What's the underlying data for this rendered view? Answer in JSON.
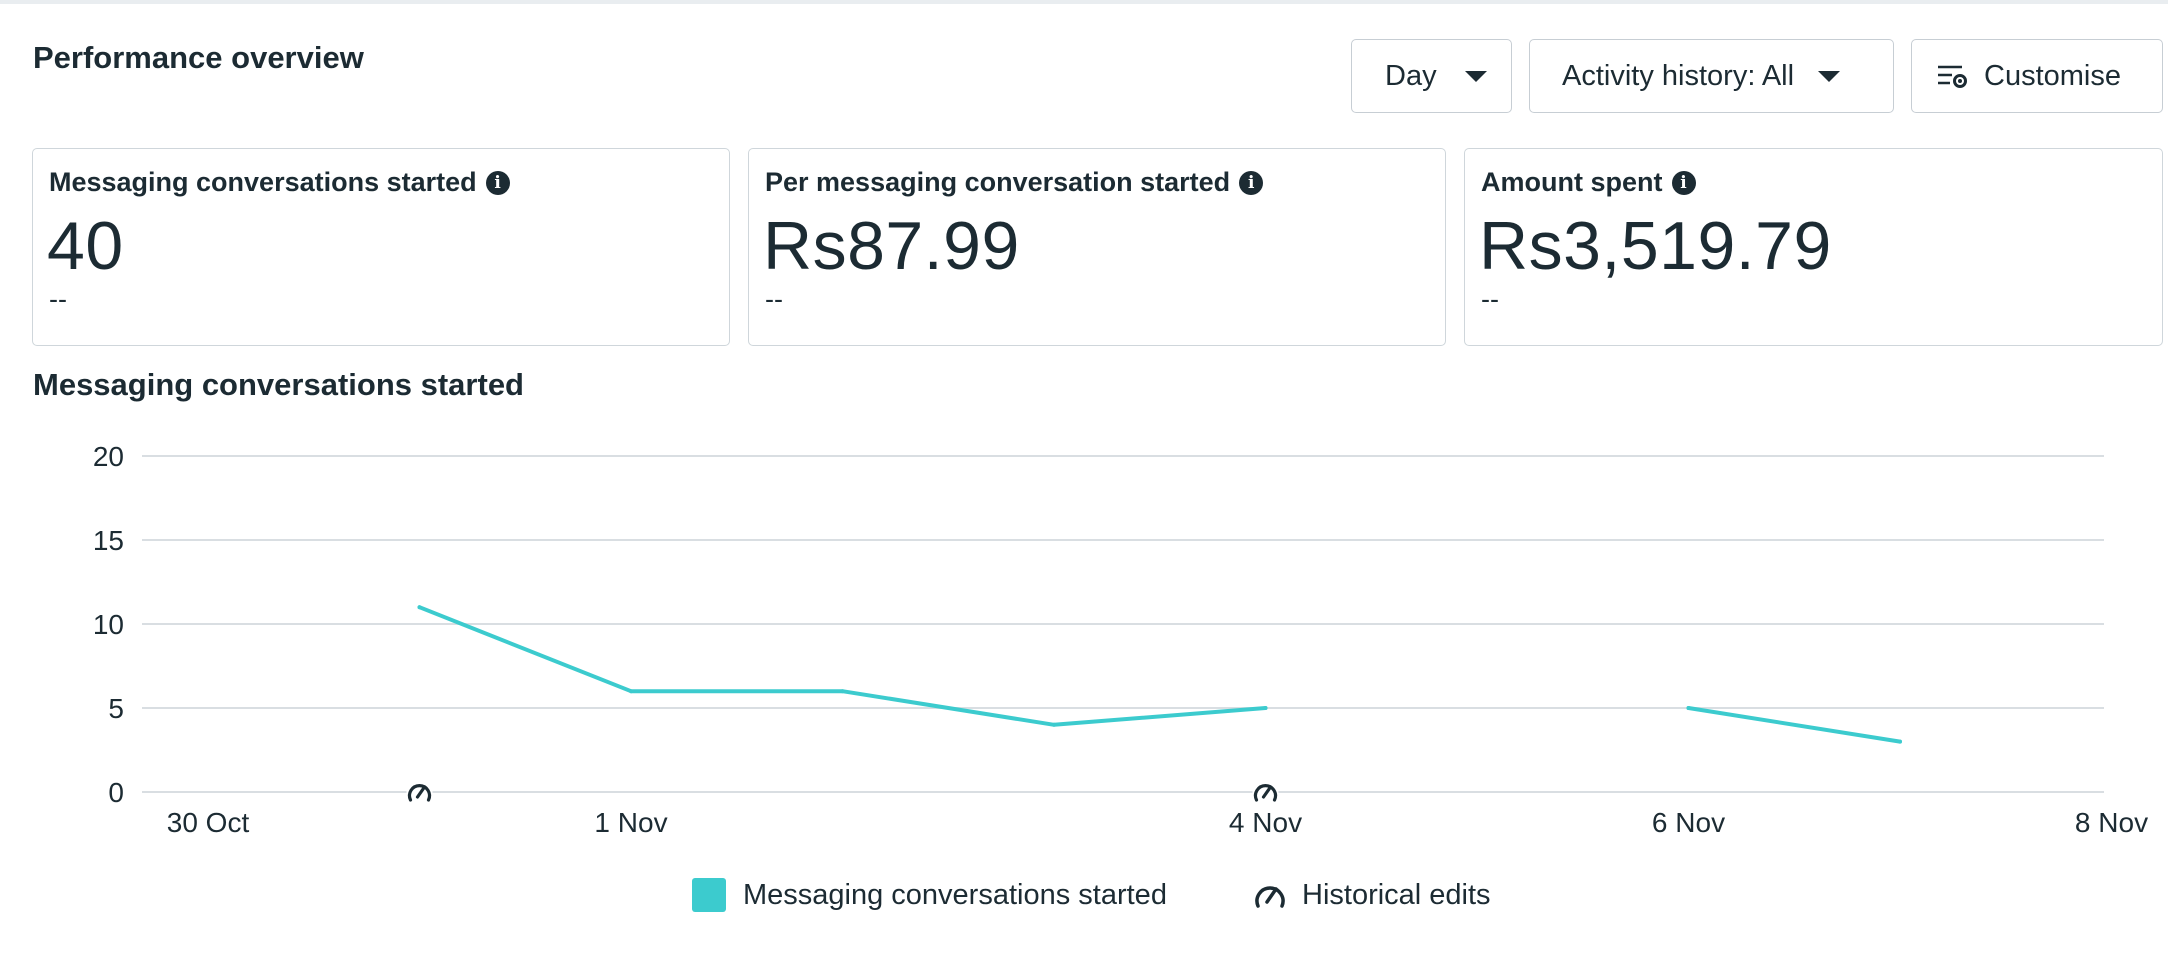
{
  "header": {
    "title": "Performance overview",
    "day_label": "Day",
    "activity_label": "Activity history: All",
    "customise_label": "Customise"
  },
  "metrics": [
    {
      "label": "Messaging conversations started",
      "value": "40",
      "delta": "--"
    },
    {
      "label": "Per messaging conversation started",
      "value": "Rs87.99",
      "delta": "--"
    },
    {
      "label": "Amount spent",
      "value": "Rs3,519.79",
      "delta": "--"
    }
  ],
  "chart_data": {
    "type": "line",
    "title": "Messaging conversations started",
    "x_tick_labels": [
      "30 Oct",
      "1 Nov",
      "4 Nov",
      "6 Nov",
      "8 Nov"
    ],
    "y_ticks": [
      0,
      5,
      10,
      15,
      20
    ],
    "ylim": [
      0,
      20
    ],
    "grid": true,
    "series": [
      {
        "name": "Messaging conversations started",
        "color": "#3ccbce",
        "segments": [
          [
            {
              "x": "31 Oct",
              "y": 11
            },
            {
              "x": "1 Nov",
              "y": 6
            },
            {
              "x": "2 Nov",
              "y": 6
            },
            {
              "x": "3 Nov",
              "y": 4
            },
            {
              "x": "4 Nov",
              "y": 5
            }
          ],
          [
            {
              "x": "6 Nov",
              "y": 5
            },
            {
              "x": "7 Nov",
              "y": 3
            }
          ]
        ]
      }
    ],
    "historical_edits": [
      "31 Oct",
      "4 Nov"
    ],
    "legend": [
      "Messaging conversations started",
      "Historical edits"
    ]
  },
  "legend": {
    "series_label": "Messaging conversations started",
    "edits_label": "Historical edits",
    "series_color": "#3ccbce"
  }
}
